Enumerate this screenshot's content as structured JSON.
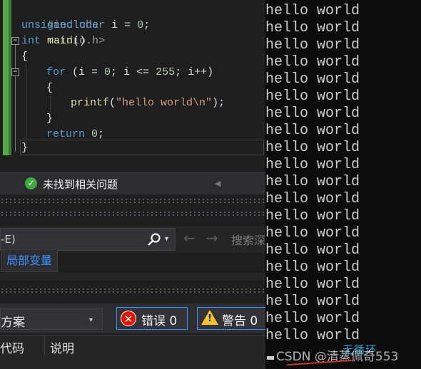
{
  "editor": {
    "line1": {
      "pp": "#include",
      "lib": "<stdio.h>"
    },
    "line2": {
      "kw1": "unsigned",
      "kw2": "char",
      "rest": " i = ",
      "num": "0",
      "end": ";"
    },
    "line3": {
      "kw": "int",
      "fn": " main",
      "rest": "()"
    },
    "line4": {
      "text": "{"
    },
    "line5": {
      "kw": "for",
      "p1": " (i = ",
      "n1": "0",
      "p2": "; i <= ",
      "n2": "255",
      "p3": "; i++)"
    },
    "line6": {
      "text": "{"
    },
    "line7": {
      "fn": "printf",
      "p1": "(",
      "str": "\"hello world\\n\"",
      "p2": ");"
    },
    "line8": {
      "text": "}"
    },
    "line9": {
      "kw": "return",
      "sp": " ",
      "num": "0",
      "end": ";"
    },
    "line10": {
      "text": "}"
    },
    "fold_symbol": "−"
  },
  "console": {
    "lines": [
      "hello world",
      "hello world",
      "hello world",
      "hello world",
      "hello world",
      "hello world",
      "hello world",
      "hello world",
      "hello world",
      "hello world",
      "hello world",
      "hello world",
      "hello world",
      "hello world",
      "hello world",
      "hello world",
      "hello world",
      "hello world",
      "hello world",
      "hello world"
    ],
    "watermark": "CSDN @清蒸佩奇553",
    "watermark_logo": "无循环"
  },
  "status": {
    "check_symbol": "✓",
    "text": "未找到相关问题",
    "arrow": "◀"
  },
  "search": {
    "box_text": "-E)",
    "dropdown_arrow": "▾",
    "back_icon": "←",
    "forward_icon": "→",
    "depth_label": "搜索深"
  },
  "locals": {
    "tab_label": "局部变量"
  },
  "error_list": {
    "scope_text": "方案",
    "scope_arrow": "▾",
    "errors_icon": "✕",
    "errors_label": "错误 0",
    "warnings_icon": "!",
    "warnings_label": "警告 0",
    "col_code": "代码",
    "col_description": "说明"
  },
  "colors": {
    "editor_bg": "#1e1e1e",
    "console_bg": "#0c0c0c",
    "keyword": "#569cd6",
    "string": "#d69d85",
    "accent": "#3794ff",
    "error_red": "#e51400",
    "warning_yellow": "#f4c22b",
    "gutter_green": "#57a64a"
  }
}
